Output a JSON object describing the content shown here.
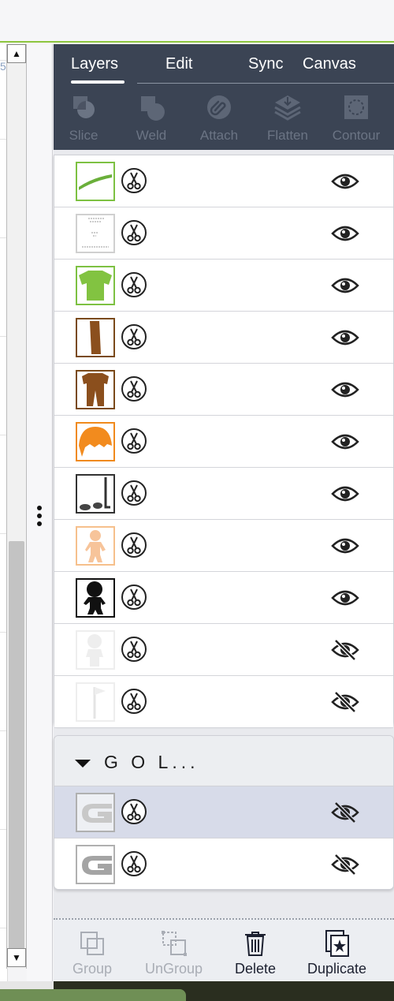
{
  "tabs": [
    {
      "label": "Layers",
      "active": true
    },
    {
      "label": "Edit",
      "active": false
    },
    {
      "label": "Sync",
      "active": false
    },
    {
      "label": "Canvas",
      "active": false
    }
  ],
  "tools": [
    {
      "label": "Slice",
      "icon": "slice-icon",
      "enabled": false
    },
    {
      "label": "Weld",
      "icon": "weld-icon",
      "enabled": false
    },
    {
      "label": "Attach",
      "icon": "paperclip-icon",
      "enabled": false
    },
    {
      "label": "Flatten",
      "icon": "flatten-icon",
      "enabled": false
    },
    {
      "label": "Contour",
      "icon": "contour-icon",
      "enabled": false
    }
  ],
  "ruler_mark": "5",
  "layers": [
    {
      "thumb": "grass",
      "border": "#7dc142",
      "visible": true
    },
    {
      "thumb": "text-sketch",
      "border": "#cfcfcf",
      "visible": true
    },
    {
      "thumb": "green-shirt",
      "border": "#7dc142",
      "visible": true
    },
    {
      "thumb": "brown-bar",
      "border": "#7a4a1a",
      "visible": true
    },
    {
      "thumb": "brown-pants",
      "border": "#7a4a1a",
      "visible": true
    },
    {
      "thumb": "orange-hair",
      "border": "#f08a1c",
      "visible": true
    },
    {
      "thumb": "golf-club-shoes",
      "border": "#333333",
      "visible": true
    },
    {
      "thumb": "skin-body",
      "border": "#f6c08c",
      "visible": true
    },
    {
      "thumb": "black-silhouette",
      "border": "#111111",
      "visible": true
    },
    {
      "thumb": "white-figure",
      "border": "#eeeeee",
      "visible": false
    },
    {
      "thumb": "white-flag",
      "border": "#eeeeee",
      "visible": false
    }
  ],
  "group": {
    "title": "G O L...",
    "layers": [
      {
        "thumb": "letter-g-light",
        "border": "#b0b0b0",
        "visible": false,
        "selected": true
      },
      {
        "thumb": "letter-g-gray",
        "border": "#b0b0b0",
        "visible": false,
        "selected": false
      }
    ]
  },
  "bottom_toolbar": [
    {
      "label": "Group",
      "icon": "group-icon",
      "enabled": false
    },
    {
      "label": "UnGroup",
      "icon": "ungroup-icon",
      "enabled": false
    },
    {
      "label": "Delete",
      "icon": "trash-icon",
      "enabled": true
    },
    {
      "label": "Duplicate",
      "icon": "duplicate-icon",
      "enabled": true
    }
  ],
  "colors": {
    "header_bg": "#3b4454",
    "accent_green": "#8dc63f",
    "selected_row": "#d7dbe9"
  }
}
